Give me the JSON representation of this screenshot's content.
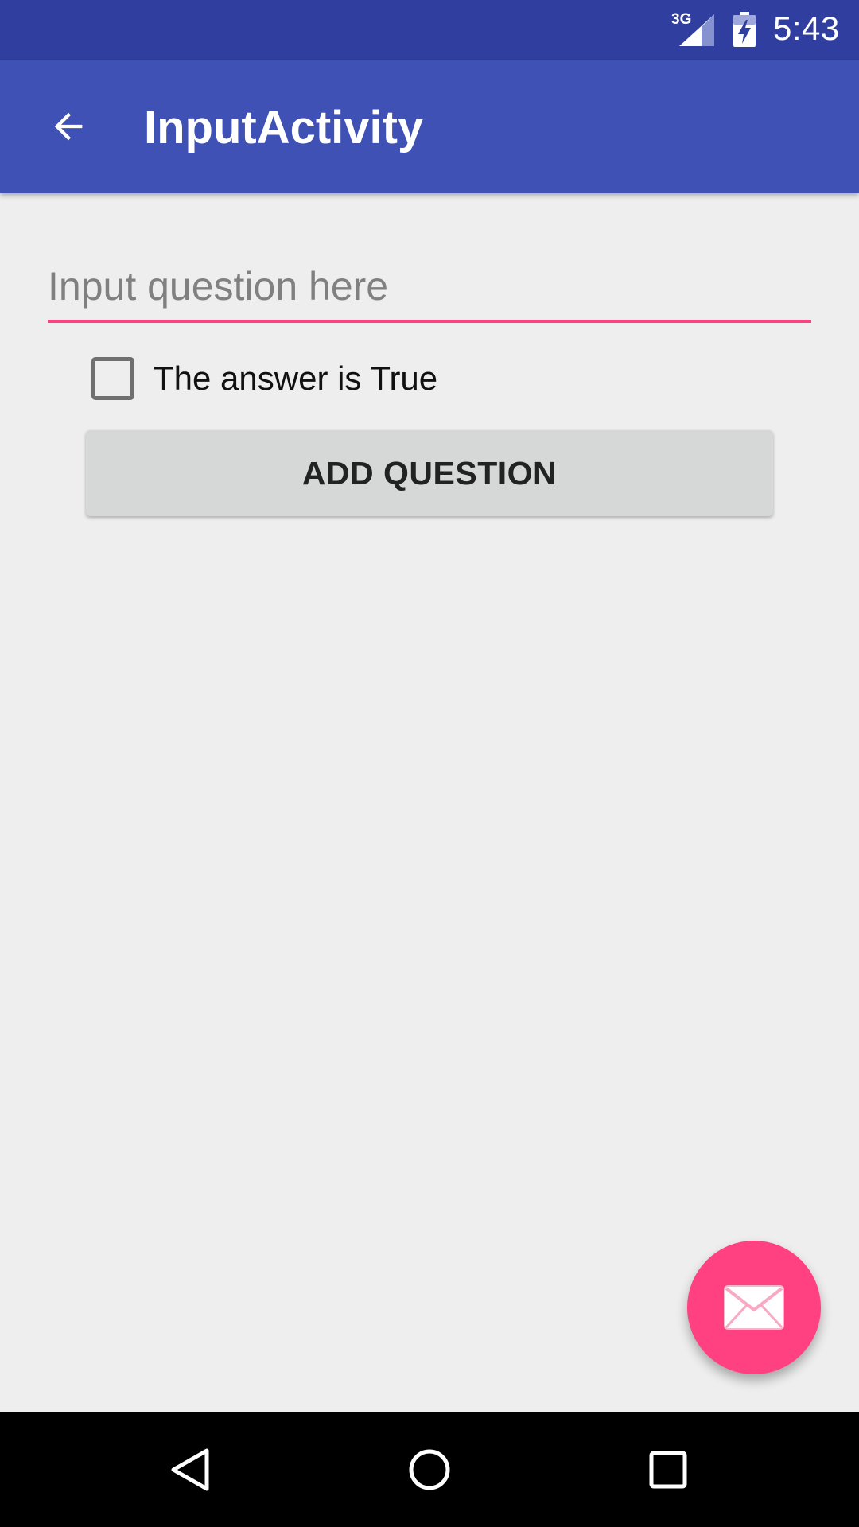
{
  "status_bar": {
    "network_label": "3G",
    "time": "5:43",
    "icons": [
      "signal-icon",
      "battery-charging-icon"
    ]
  },
  "toolbar": {
    "title": "InputActivity",
    "back_icon": "arrow-back-icon"
  },
  "form": {
    "question_input": {
      "value": "",
      "placeholder": "Input question here"
    },
    "answer_checkbox": {
      "label": "The answer is True",
      "checked": false
    },
    "add_button_label": "ADD QUESTION"
  },
  "fab": {
    "icon": "mail-icon"
  },
  "nav_bar": {
    "icons": [
      "nav-back-icon",
      "nav-home-icon",
      "nav-recents-icon"
    ]
  },
  "colors": {
    "status_bar": "#303F9F",
    "primary": "#3F51B5",
    "accent": "#FF4081",
    "background": "#EEEEEE",
    "button": "#D6D7D7"
  }
}
